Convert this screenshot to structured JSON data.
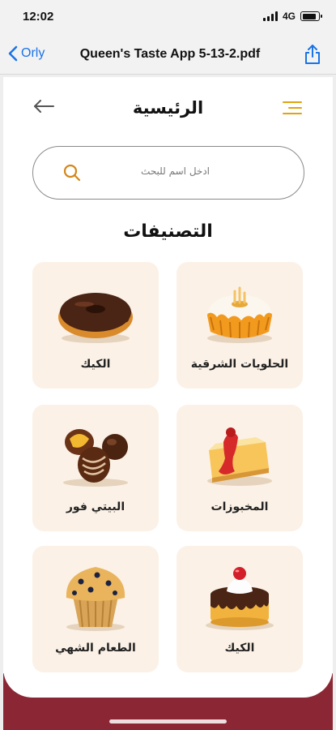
{
  "status_bar": {
    "time": "12:02",
    "network": "4G",
    "battery_level": 0.85
  },
  "viewer": {
    "back_label": "Orly",
    "document_title": "Queen's Taste App 5-13-2.pdf"
  },
  "app": {
    "page_title": "الرئيسية",
    "search": {
      "placeholder": "ادخل اسم للبحث"
    },
    "section_title": "التصنيفات",
    "categories": [
      {
        "label": "الحلويات الشرقية",
        "icon": "bundt-cake-icon"
      },
      {
        "label": "الكيك",
        "icon": "donut-icon"
      },
      {
        "label": "المخبوزات",
        "icon": "cheesecake-slice-icon"
      },
      {
        "label": "البيتي فور",
        "icon": "chocolate-truffles-icon"
      },
      {
        "label": "الكيك",
        "icon": "cherry-cake-icon"
      },
      {
        "label": "الطعام الشهي",
        "icon": "muffin-icon"
      }
    ],
    "colors": {
      "accent": "#e0a312",
      "tile_background": "#fbf1e6",
      "footer": "#8b2734"
    }
  }
}
